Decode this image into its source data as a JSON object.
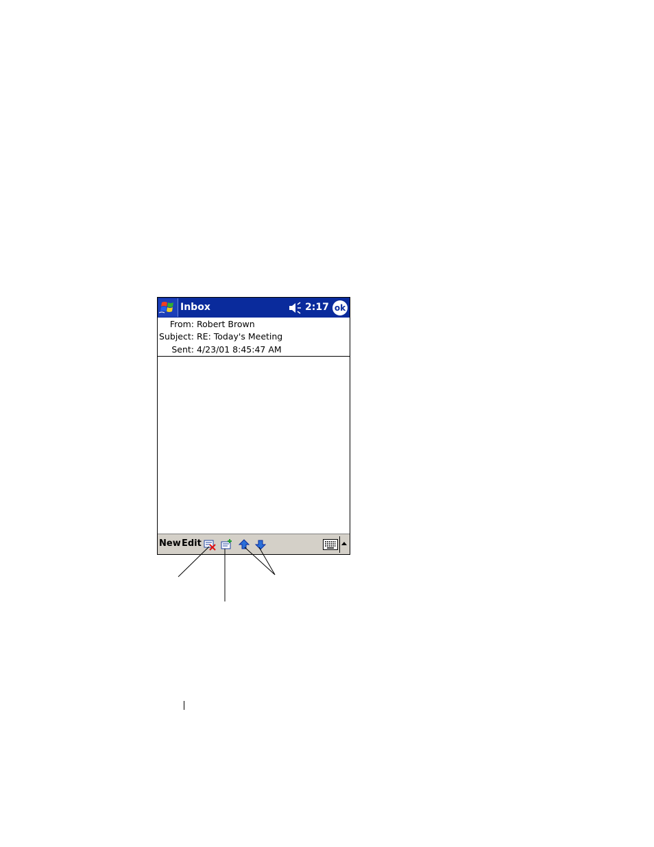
{
  "titlebar": {
    "start_icon": "windows-flag-icon",
    "title": "Inbox",
    "speaker_icon": "speaker-icon",
    "time": "2:17",
    "ok_label": "ok"
  },
  "message_header": {
    "from_label": "From:",
    "from_value": "Robert Brown",
    "subject_label": "Subject:",
    "subject_value": "RE: Today's Meeting",
    "sent_label": "Sent:",
    "sent_value": "4/23/01 8:45:47 AM"
  },
  "menubar": {
    "new_label": "New",
    "edit_label": "Edit",
    "tools": [
      "delete-message-icon",
      "reply-message-icon",
      "previous-message-icon",
      "next-message-icon"
    ],
    "keyboard_icon": "keyboard-icon",
    "sip_arrow_icon": "sip-arrow-icon"
  },
  "colors": {
    "titlebar_bg": "#0a2b9c",
    "menubar_bg": "#d4d0c8",
    "delete_red": "#e01010",
    "arrow_blue": "#2a6fd8"
  }
}
